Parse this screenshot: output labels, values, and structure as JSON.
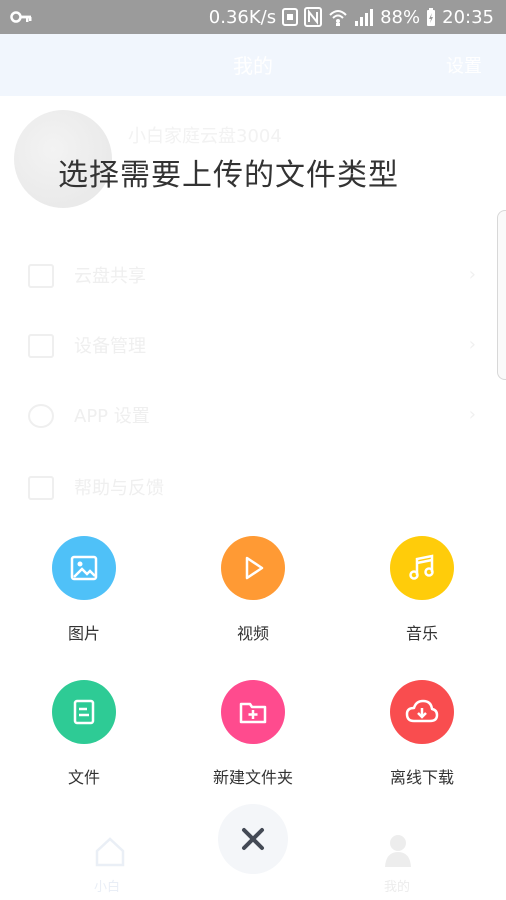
{
  "status_bar": {
    "speed": "0.36K/s",
    "battery": "88%",
    "time": "20:35"
  },
  "app_behind": {
    "header_title": "我的",
    "header_action": "设置",
    "device_name": "小白家庭云盘3004",
    "menu": [
      {
        "label": "云盘共享",
        "icon": "share-icon"
      },
      {
        "label": "设备管理",
        "icon": "device-icon"
      },
      {
        "label": "APP 设置",
        "icon": "settings-icon"
      },
      {
        "label": "帮助与反馈",
        "icon": "help-icon"
      }
    ],
    "tabs": [
      {
        "label": "小白",
        "icon": "home-icon"
      },
      {
        "label": "我的",
        "icon": "person-icon"
      }
    ]
  },
  "upload_sheet": {
    "title": "选择需要上传的文件类型",
    "options": [
      {
        "label": "图片",
        "icon": "image-icon",
        "color": "#4fc1f8"
      },
      {
        "label": "视频",
        "icon": "play-icon",
        "color": "#ff9a34"
      },
      {
        "label": "音乐",
        "icon": "music-icon",
        "color": "#ffcc0a"
      },
      {
        "label": "文件",
        "icon": "document-icon",
        "color": "#2ecb95"
      },
      {
        "label": "新建文件夹",
        "icon": "new-folder-icon",
        "color": "#ff4b8e"
      },
      {
        "label": "离线下载",
        "icon": "cloud-download-icon",
        "color": "#f94d4f"
      }
    ],
    "close_icon": "close-icon"
  }
}
